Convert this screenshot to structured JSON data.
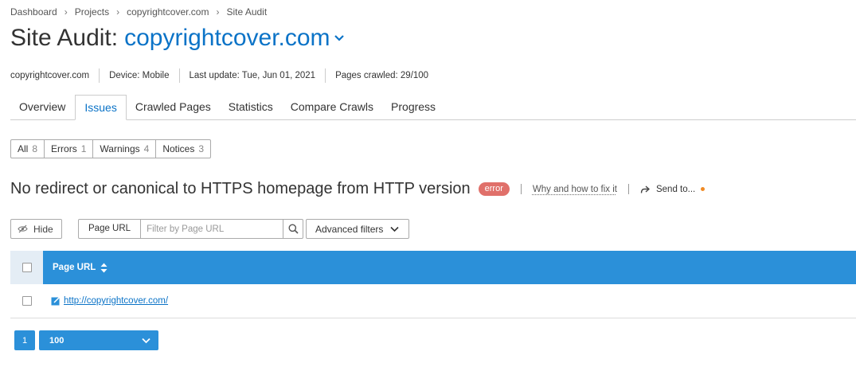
{
  "breadcrumb": [
    "Dashboard",
    "Projects",
    "copyrightcover.com",
    "Site Audit"
  ],
  "title": {
    "prefix": "Site Audit:",
    "domain": "copyrightcover.com"
  },
  "meta": {
    "domain": "copyrightcover.com",
    "device": "Device: Mobile",
    "last_update": "Last update: Tue, Jun 01, 2021",
    "pages_crawled": "Pages crawled: 29/100"
  },
  "tabs": [
    "Overview",
    "Issues",
    "Crawled Pages",
    "Statistics",
    "Compare Crawls",
    "Progress"
  ],
  "active_tab": "Issues",
  "filters": [
    {
      "label": "All",
      "count": "8"
    },
    {
      "label": "Errors",
      "count": "1"
    },
    {
      "label": "Warnings",
      "count": "4"
    },
    {
      "label": "Notices",
      "count": "3"
    }
  ],
  "issue": {
    "title": "No redirect or canonical to HTTPS homepage from HTTP version",
    "badge": "error",
    "how_to": "Why and how to fix it",
    "send": "Send to..."
  },
  "toolbar": {
    "hide": "Hide",
    "url_label": "Page URL",
    "url_placeholder": "Filter by Page URL",
    "advanced": "Advanced filters"
  },
  "table": {
    "column": "Page URL",
    "rows": [
      {
        "url": "http://copyrightcover.com/"
      }
    ]
  },
  "pagination": {
    "page": "1",
    "per_page": "100"
  },
  "colors": {
    "accent": "#2b90d9",
    "link": "#0b73c7",
    "error": "#e0706a",
    "dot": "#f08a24"
  }
}
